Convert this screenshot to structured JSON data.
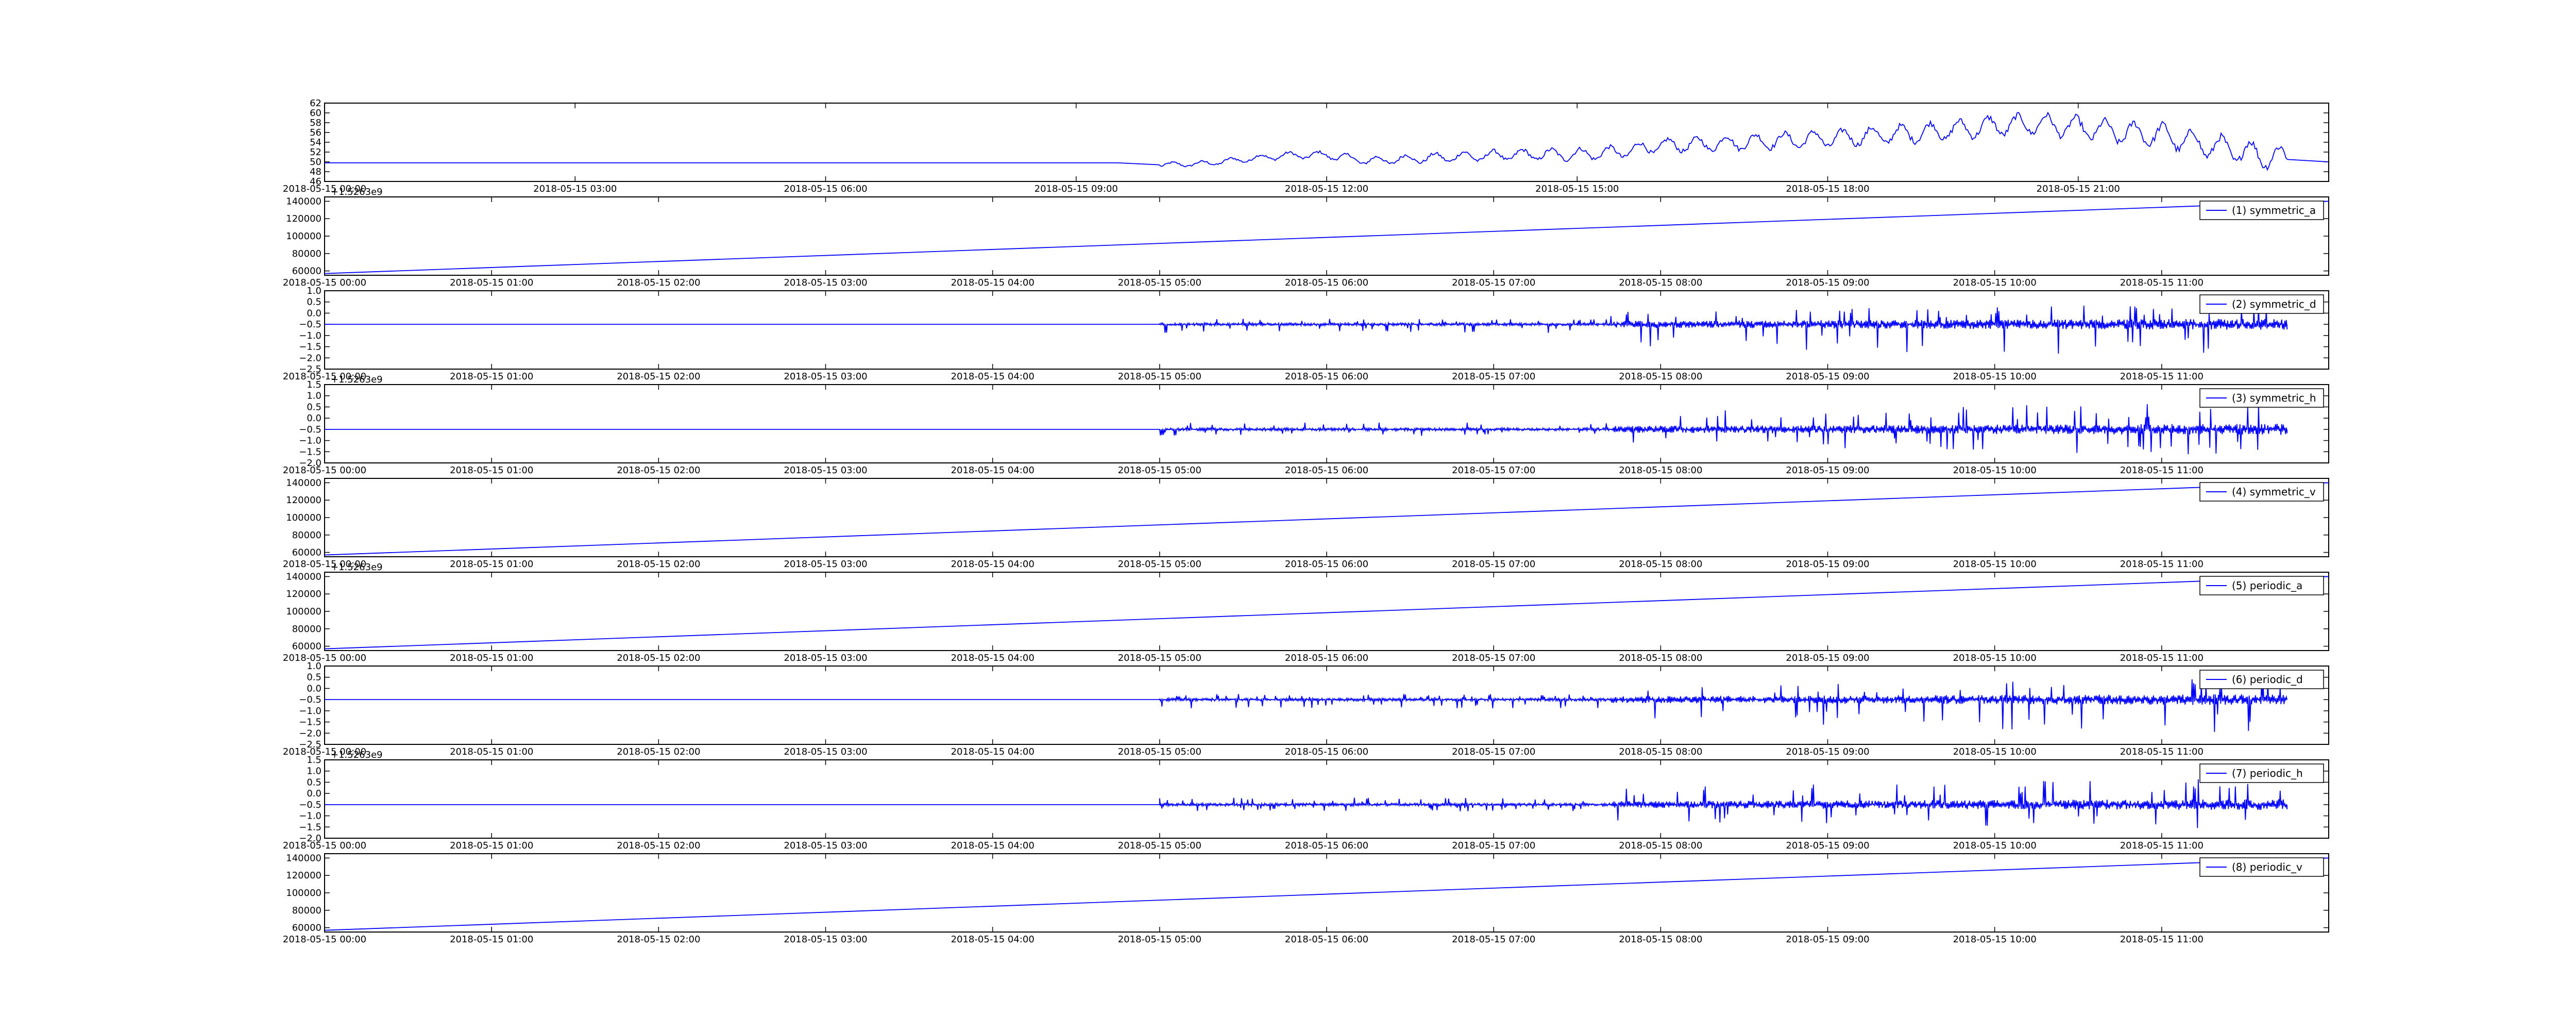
{
  "figure": {
    "series_color": "#0000ff",
    "offset_label": "+1.5263e9"
  },
  "chart_data": [
    {
      "type": "line",
      "legend": "",
      "offset_label": "",
      "ylim": [
        46,
        62
      ],
      "yticks": [
        "46",
        "48",
        "50",
        "52",
        "54",
        "56",
        "58",
        "60",
        "62"
      ],
      "xticks": [
        "2018-05-15 00:00",
        "2018-05-15 03:00",
        "2018-05-15 06:00",
        "2018-05-15 09:00",
        "2018-05-15 12:00",
        "2018-05-15 15:00",
        "2018-05-15 18:00",
        "2018-05-15 21:00"
      ],
      "pattern": "env",
      "x_start_hour": 0,
      "x_end_hour": 24,
      "data_end_hour": 23.5,
      "baseline": 49.8,
      "active_from_hour": 10,
      "points": [
        [
          0,
          49.8
        ],
        [
          9.5,
          49.8
        ],
        [
          10,
          49.4
        ],
        [
          10.5,
          49.6
        ],
        [
          11,
          50.5
        ],
        [
          11.5,
          51.3
        ],
        [
          12,
          51.4
        ],
        [
          12.5,
          50.2
        ],
        [
          13,
          50.6
        ],
        [
          13.5,
          51.0
        ],
        [
          14,
          51.3
        ],
        [
          14.5,
          51.5
        ],
        [
          15,
          51.5
        ],
        [
          15.5,
          52.0
        ],
        [
          16,
          53.3
        ],
        [
          16.5,
          53.6
        ],
        [
          17,
          54.0
        ],
        [
          17.5,
          54.4
        ],
        [
          18,
          54.7
        ],
        [
          18.5,
          55.3
        ],
        [
          19,
          55.8
        ],
        [
          19.5,
          56.5
        ],
        [
          20,
          57.3
        ],
        [
          20.5,
          57.8
        ],
        [
          21,
          57.0
        ],
        [
          21.5,
          56.0
        ],
        [
          22,
          55.5
        ],
        [
          22.5,
          53.5
        ],
        [
          23,
          52.0
        ],
        [
          23.5,
          50.5
        ],
        [
          24,
          50.0
        ]
      ]
    },
    {
      "type": "line",
      "legend": "(1) symmetric_a",
      "offset_label": "+1.5263e9",
      "ylim": [
        55000,
        145000
      ],
      "yticks": [
        "60000",
        "80000",
        "100000",
        "120000",
        "140000"
      ],
      "xticks": [
        "2018-05-15 00:00",
        "2018-05-15 01:00",
        "2018-05-15 02:00",
        "2018-05-15 03:00",
        "2018-05-15 04:00",
        "2018-05-15 05:00",
        "2018-05-15 06:00",
        "2018-05-15 07:00",
        "2018-05-15 08:00",
        "2018-05-15 09:00",
        "2018-05-15 10:00",
        "2018-05-15 11:00"
      ],
      "pattern": "ramp",
      "x_start_hour": 0,
      "x_end_hour": 12,
      "data_end_hour": 12,
      "points": [
        [
          0,
          57000
        ],
        [
          12,
          140000
        ]
      ]
    },
    {
      "type": "line",
      "legend": "(2) symmetric_d",
      "offset_label": "",
      "ylim": [
        -2.5,
        1.0
      ],
      "yticks": [
        "−2.5",
        "−2.0",
        "−1.5",
        "−1.0",
        "−0.5",
        "0.0",
        "0.5",
        "1.0"
      ],
      "xticks": [
        "2018-05-15 00:00",
        "2018-05-15 01:00",
        "2018-05-15 02:00",
        "2018-05-15 03:00",
        "2018-05-15 04:00",
        "2018-05-15 05:00",
        "2018-05-15 06:00",
        "2018-05-15 07:00",
        "2018-05-15 08:00",
        "2018-05-15 09:00",
        "2018-05-15 10:00",
        "2018-05-15 11:00"
      ],
      "pattern": "noise",
      "x_start_hour": 0,
      "x_end_hour": 12,
      "data_end_hour": 11.75,
      "baseline": -0.5,
      "active_from_hour": 5,
      "up_max": 1.0,
      "down_max": 1.6
    },
    {
      "type": "line",
      "legend": "(3) symmetric_h",
      "offset_label": "+1.5263e9",
      "ylim": [
        -2.0,
        1.5
      ],
      "yticks": [
        "−2.0",
        "−1.5",
        "−1.0",
        "−0.5",
        "0.0",
        "0.5",
        "1.0",
        "1.5"
      ],
      "xticks": [
        "2018-05-15 00:00",
        "2018-05-15 01:00",
        "2018-05-15 02:00",
        "2018-05-15 03:00",
        "2018-05-15 04:00",
        "2018-05-15 05:00",
        "2018-05-15 06:00",
        "2018-05-15 07:00",
        "2018-05-15 08:00",
        "2018-05-15 09:00",
        "2018-05-15 10:00",
        "2018-05-15 11:00"
      ],
      "pattern": "noise",
      "x_start_hour": 0,
      "x_end_hour": 12,
      "data_end_hour": 11.75,
      "baseline": -0.5,
      "active_from_hour": 5,
      "up_max": 1.3,
      "down_max": 1.2
    },
    {
      "type": "line",
      "legend": "(4) symmetric_v",
      "offset_label": "",
      "ylim": [
        55000,
        145000
      ],
      "yticks": [
        "60000",
        "80000",
        "100000",
        "120000",
        "140000"
      ],
      "xticks": [
        "2018-05-15 00:00",
        "2018-05-15 01:00",
        "2018-05-15 02:00",
        "2018-05-15 03:00",
        "2018-05-15 04:00",
        "2018-05-15 05:00",
        "2018-05-15 06:00",
        "2018-05-15 07:00",
        "2018-05-15 08:00",
        "2018-05-15 09:00",
        "2018-05-15 10:00",
        "2018-05-15 11:00"
      ],
      "pattern": "ramp",
      "x_start_hour": 0,
      "x_end_hour": 12,
      "data_end_hour": 12,
      "points": [
        [
          0,
          57000
        ],
        [
          12,
          140000
        ]
      ]
    },
    {
      "type": "line",
      "legend": "(5) periodic_a",
      "offset_label": "+1.5263e9",
      "ylim": [
        55000,
        145000
      ],
      "yticks": [
        "60000",
        "80000",
        "100000",
        "120000",
        "140000"
      ],
      "xticks": [
        "2018-05-15 00:00",
        "2018-05-15 01:00",
        "2018-05-15 02:00",
        "2018-05-15 03:00",
        "2018-05-15 04:00",
        "2018-05-15 05:00",
        "2018-05-15 06:00",
        "2018-05-15 07:00",
        "2018-05-15 08:00",
        "2018-05-15 09:00",
        "2018-05-15 10:00",
        "2018-05-15 11:00"
      ],
      "pattern": "ramp",
      "x_start_hour": 0,
      "x_end_hour": 12,
      "data_end_hour": 12,
      "points": [
        [
          0,
          57000
        ],
        [
          12,
          140000
        ]
      ]
    },
    {
      "type": "line",
      "legend": "(6) periodic_d",
      "offset_label": "",
      "ylim": [
        -2.5,
        1.0
      ],
      "yticks": [
        "−2.5",
        "−2.0",
        "−1.5",
        "−1.0",
        "−0.5",
        "0.0",
        "0.5",
        "1.0"
      ],
      "xticks": [
        "2018-05-15 00:00",
        "2018-05-15 01:00",
        "2018-05-15 02:00",
        "2018-05-15 03:00",
        "2018-05-15 04:00",
        "2018-05-15 05:00",
        "2018-05-15 06:00",
        "2018-05-15 07:00",
        "2018-05-15 08:00",
        "2018-05-15 09:00",
        "2018-05-15 10:00",
        "2018-05-15 11:00"
      ],
      "pattern": "noise",
      "x_start_hour": 0,
      "x_end_hour": 12,
      "data_end_hour": 11.75,
      "baseline": -0.5,
      "active_from_hour": 5,
      "up_max": 1.0,
      "down_max": 1.6
    },
    {
      "type": "line",
      "legend": "(7) periodic_h",
      "offset_label": "+1.5263e9",
      "ylim": [
        -2.0,
        1.5
      ],
      "yticks": [
        "−2.0",
        "−1.5",
        "−1.0",
        "−0.5",
        "0.0",
        "0.5",
        "1.0",
        "1.5"
      ],
      "xticks": [
        "2018-05-15 00:00",
        "2018-05-15 01:00",
        "2018-05-15 02:00",
        "2018-05-15 03:00",
        "2018-05-15 04:00",
        "2018-05-15 05:00",
        "2018-05-15 06:00",
        "2018-05-15 07:00",
        "2018-05-15 08:00",
        "2018-05-15 09:00",
        "2018-05-15 10:00",
        "2018-05-15 11:00"
      ],
      "pattern": "noise",
      "x_start_hour": 0,
      "x_end_hour": 12,
      "data_end_hour": 11.75,
      "baseline": -0.5,
      "active_from_hour": 5,
      "up_max": 1.3,
      "down_max": 1.2
    },
    {
      "type": "line",
      "legend": "(8) periodic_v",
      "offset_label": "",
      "ylim": [
        55000,
        145000
      ],
      "yticks": [
        "60000",
        "80000",
        "100000",
        "120000",
        "140000"
      ],
      "xticks": [
        "2018-05-15 00:00",
        "2018-05-15 01:00",
        "2018-05-15 02:00",
        "2018-05-15 03:00",
        "2018-05-15 04:00",
        "2018-05-15 05:00",
        "2018-05-15 06:00",
        "2018-05-15 07:00",
        "2018-05-15 08:00",
        "2018-05-15 09:00",
        "2018-05-15 10:00",
        "2018-05-15 11:00"
      ],
      "pattern": "ramp",
      "x_start_hour": 0,
      "x_end_hour": 12,
      "data_end_hour": 12,
      "points": [
        [
          0,
          57000
        ],
        [
          12,
          140000
        ]
      ]
    }
  ]
}
